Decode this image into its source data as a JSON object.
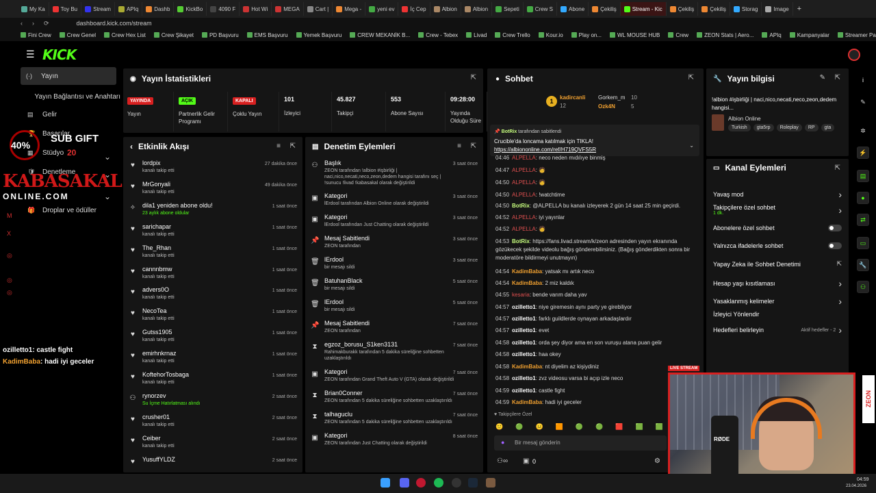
{
  "browser": {
    "tabs": [
      "My Ka",
      "Toy Bu",
      "Stream",
      "APIq",
      "Dashb",
      "KickBo",
      "4090 F",
      "Hot Wi",
      "MEGA",
      "Cart |",
      "Mega -",
      "yeni ev",
      "İç Cep",
      "Albion",
      "Albion",
      "Sepeti",
      "Crew S",
      "Abone",
      "Çekiliş",
      "Stream - Kic",
      "Çekiliş",
      "Çekiliş",
      "Storag",
      "Image"
    ],
    "url": "dashboard.kick.com/stream"
  },
  "bookmarks": [
    "Fini Crew",
    "Crew Genel",
    "Crew Hex List",
    "Crew Şikayet",
    "PD Başvuru",
    "EMS Başvuru",
    "Yemek Başvuru",
    "CREW MEKANİK B...",
    "Crew - Tebex",
    "Livad",
    "Crew Trello",
    "Kour.io",
    "Play on...",
    "WL MOUSE HUB",
    "Crew",
    "ZEON Stats | Aero...",
    "APIq",
    "Kampanyalar",
    "Streamer Panel"
  ],
  "logo": "KICK",
  "sidebar": {
    "items": [
      "Yayın",
      "Yayın Bağlantısı ve Anahtarı",
      "Gelir",
      "Başarılar",
      "Stüdyo",
      "Denetleme",
      "Droplar ve ödüller"
    ]
  },
  "overlay": {
    "subgift": "SUB GIFT",
    "percent": "40%",
    "count": "20",
    "brand": "KABASAKAL",
    "brand2": "ONLINE.COM",
    "chat": [
      {
        "user": "ozilletto1",
        "msg": ": castle fight"
      },
      {
        "user": "KadimBaba",
        "msg": ": hadi iyi geceler"
      }
    ]
  },
  "stats": {
    "title": "Yayın İstatistikleri",
    "cells": [
      {
        "badge": "YAYINDA",
        "label": "Yayın"
      },
      {
        "badge": "AÇIK",
        "label": "Partnerlik Gelir Programı"
      },
      {
        "badge": "KAPALI",
        "label": "Çoklu Yayın"
      },
      {
        "value": "101",
        "label": "İzleyici"
      },
      {
        "value": "45.827",
        "label": "Takipçi"
      },
      {
        "value": "553",
        "label": "Abone Sayısı"
      },
      {
        "value": "09:28:00",
        "label": "Yayında Olduğu Süre"
      }
    ]
  },
  "activity": {
    "title": "Etkinlik Akışı",
    "items": [
      {
        "n": "lordpix",
        "s": "kanalı takip etti",
        "t": "27 dakika önce"
      },
      {
        "n": "MrGonyali",
        "s": "kanalı takip etti",
        "t": "49 dakika önce"
      },
      {
        "n": "dila1 yeniden abone oldu!",
        "s": "23 aylık abone oldular",
        "t": "1 saat önce"
      },
      {
        "n": "sarichapar",
        "s": "kanalı takip etti",
        "t": "1 saat önce"
      },
      {
        "n": "The_Rhan",
        "s": "kanalı takip etti",
        "t": "1 saat önce"
      },
      {
        "n": "cannnbmw",
        "s": "kanalı takip etti",
        "t": "1 saat önce"
      },
      {
        "n": "advers0O",
        "s": "kanalı takip etti",
        "t": "1 saat önce"
      },
      {
        "n": "NecoTea",
        "s": "kanalı takip etti",
        "t": "1 saat önce"
      },
      {
        "n": "Gutss1905",
        "s": "kanalı takip etti",
        "t": "1 saat önce"
      },
      {
        "n": "emirhnkrnaz",
        "s": "kanalı takip etti",
        "t": "1 saat önce"
      },
      {
        "n": "KoftehorTosbaga",
        "s": "kanalı takip etti",
        "t": "1 saat önce"
      },
      {
        "n": "rynorzev",
        "s": "Su İçme Hatırlatması alındı",
        "t": "2 saat önce"
      },
      {
        "n": "crusher01",
        "s": "kanalı takip etti",
        "t": "2 saat önce"
      },
      {
        "n": "Ceiber",
        "s": "kanalı takip etti",
        "t": "2 saat önce"
      },
      {
        "n": "YusuffYLDZ",
        "s": "",
        "t": "2 saat önce"
      }
    ]
  },
  "moderation": {
    "title": "Denetim Eylemleri",
    "items": [
      {
        "n": "Başlık",
        "s": "ZEON tarafından !albion #işbirliği | naci,nico,necati,neco,zeon,dedem hangisi tarafını seç | !sunucu !livad !kabasakal olarak değiştirildi",
        "t": "3 saat önce"
      },
      {
        "n": "Kategori",
        "s": "lErdool tarafından Albion Online olarak değiştirildi",
        "t": "3 saat önce"
      },
      {
        "n": "Kategori",
        "s": "lErdool tarafından Just Chatting olarak değiştirildi",
        "t": "3 saat önce"
      },
      {
        "n": "Mesaj Sabitlendi",
        "s": "ZEON tarafından",
        "t": "3 saat önce"
      },
      {
        "n": "lErdool",
        "s": "bir mesajı sildi",
        "t": "3 saat önce"
      },
      {
        "n": "BatuhanBlack",
        "s": "bir mesajı sildi",
        "t": "5 saat önce"
      },
      {
        "n": "lErdool",
        "s": "bir mesajı sildi",
        "t": "5 saat önce"
      },
      {
        "n": "Mesaj Sabitlendi",
        "s": "ZEON tarafından",
        "t": "7 saat önce"
      },
      {
        "n": "egzoz_borusu_S1ken3131",
        "s": "Rahimakburakk tarafından 5 dakika süreliğine sohbetten uzaklaştırıldı",
        "t": "7 saat önce"
      },
      {
        "n": "Kategori",
        "s": "ZEON tarafından Grand Theft Auto V (GTA) olarak değiştirildi",
        "t": "7 saat önce"
      },
      {
        "n": "Brian0Conner",
        "s": "ZEON tarafından 5 dakika süreliğine sohbetten uzaklaştırıldı",
        "t": "7 saat önce"
      },
      {
        "n": "talhaguclu",
        "s": "ZEON tarafından 5 dakika süreliğine sohbetten uzaklaştırıldı",
        "t": "7 saat önce"
      },
      {
        "n": "Kategori",
        "s": "ZEON tarafından Just Chatting olarak değiştirildi",
        "t": "8 saat önce"
      }
    ]
  },
  "chat": {
    "title": "Sohbet",
    "top": [
      {
        "n": "kadircanli",
        "v": "12"
      },
      {
        "n": "Gorkem_m",
        "v": "10"
      },
      {
        "n": "Ozk4N",
        "v": "5"
      }
    ],
    "pinned": {
      "by": "BotRix",
      "suffix": " tarafından sabitlendi",
      "msg": "Crucible'da loncama katılmak için TIKLA!",
      "link": "https://albiononline.com/ref/H719QVFS5R"
    },
    "lines": [
      {
        "ts": "04:46",
        "u": "ALPELLA",
        "c": "u3",
        "m": "neco neden mıdılıye binmiş"
      },
      {
        "ts": "04:47",
        "u": "ALPELLA",
        "c": "u3",
        "m": "🧑"
      },
      {
        "ts": "04:50",
        "u": "ALPELLA",
        "c": "u3",
        "m": "🧑"
      },
      {
        "ts": "04:50",
        "u": "ALPELLA",
        "c": "u3",
        "m": "!watchtime"
      },
      {
        "ts": "04:50",
        "u": "BotRix",
        "c": "u1",
        "m": "@ALPELLA bu kanalı izleyerek 2 gün 14 saat 25 min geçirdi."
      },
      {
        "ts": "04:52",
        "u": "ALPELLA",
        "c": "u3",
        "m": "iyi yayınlar"
      },
      {
        "ts": "04:52",
        "u": "ALPELLA",
        "c": "u3",
        "m": "🧑"
      },
      {
        "ts": "04:53",
        "u": "BotRix",
        "c": "u1",
        "m": "https://fans.livad.stream/k/zeon adresinden yayın ekranında"
      },
      {
        "ts": "",
        "u": "",
        "c": "",
        "m": "gözükecek şekilde videolu bağış gönderebilirsiniz. (Bağış gönderdikten sonra bir"
      },
      {
        "ts": "",
        "u": "",
        "c": "",
        "m": "moderatöre bildirmeyi unutmayın)"
      },
      {
        "ts": "04:54",
        "u": "KadimBaba",
        "c": "u2",
        "m": "yatsak mı artık neco"
      },
      {
        "ts": "04:54",
        "u": "KadimBaba",
        "c": "u2",
        "m": "2 miz kaldık"
      },
      {
        "ts": "04:55",
        "u": "kesaria",
        "c": "u3",
        "m": "bende varım daha yav"
      },
      {
        "ts": "04:57",
        "u": "ozilletto1",
        "c": "",
        "m": "niye giremesin aynı party ye girebiliyor"
      },
      {
        "ts": "04:57",
        "u": "ozilletto1",
        "c": "",
        "m": "farklı guildlerde oynayan arkadaşlardır"
      },
      {
        "ts": "04:57",
        "u": "ozilletto1",
        "c": "",
        "m": "evet"
      },
      {
        "ts": "04:58",
        "u": "ozilletto1",
        "c": "",
        "m": "orda şey diyor ama en son vuruşu atana puan gelir"
      },
      {
        "ts": "04:58",
        "u": "ozilletto1",
        "c": "",
        "m": "haa okey"
      },
      {
        "ts": "04:58",
        "u": "KadimBaba",
        "c": "u2",
        "m": "nt diyelim az kişiydiniz"
      },
      {
        "ts": "04:58",
        "u": "ozilletto1",
        "c": "",
        "m": "zvz videosu varsa bi açıp izle neco"
      },
      {
        "ts": "04:59",
        "u": "ozilletto1",
        "c": "",
        "m": "castle fight"
      },
      {
        "ts": "04:59",
        "u": "KadimBaba",
        "c": "u2",
        "m": "hadi iyi geceler"
      }
    ],
    "mode": "Takipçilere Özel",
    "placeholder": "Bir mesaj gönderin",
    "count": "0"
  },
  "info": {
    "title": "Yayın bilgisi",
    "stream_title": "!albion #işbirliği | naci,nico,necati,neco,zeon,dedem hangisi...",
    "game": "Albion Online",
    "tags": [
      "Turkish",
      "gta5rp",
      "Roleplay",
      "RP",
      "gta"
    ]
  },
  "channel": {
    "title": "Kanal Eylemleri",
    "items": [
      {
        "l": "Yavaş mod",
        "k": "arrow"
      },
      {
        "l": "Takipçilere özel sohbet",
        "sub": "1 dk.",
        "k": "arrow"
      },
      {
        "l": "Abonelere özel sohbet",
        "k": "toggle"
      },
      {
        "l": "Yalnızca ifadelerle sohbet",
        "k": "toggle"
      },
      {
        "l": "Yapay Zeka ile Sohbet Denetimi",
        "k": "ext"
      },
      {
        "l": "Hesap yaşı kısıtlaması",
        "k": "arrow"
      },
      {
        "l": "Yasaklanmış kelimeler",
        "k": "arrow"
      },
      {
        "l": "İzleyici Yönlendir",
        "k": ""
      },
      {
        "l": "Hedefleri belirleyin",
        "extra": "Aktif hedefler - 2",
        "k": "arrow"
      }
    ]
  },
  "webcam": {
    "live": "LIVE STREAM",
    "brand": "ZEON",
    "mic": "RØDE"
  },
  "clock": {
    "time": "04:59",
    "date": "23.04.2026"
  }
}
